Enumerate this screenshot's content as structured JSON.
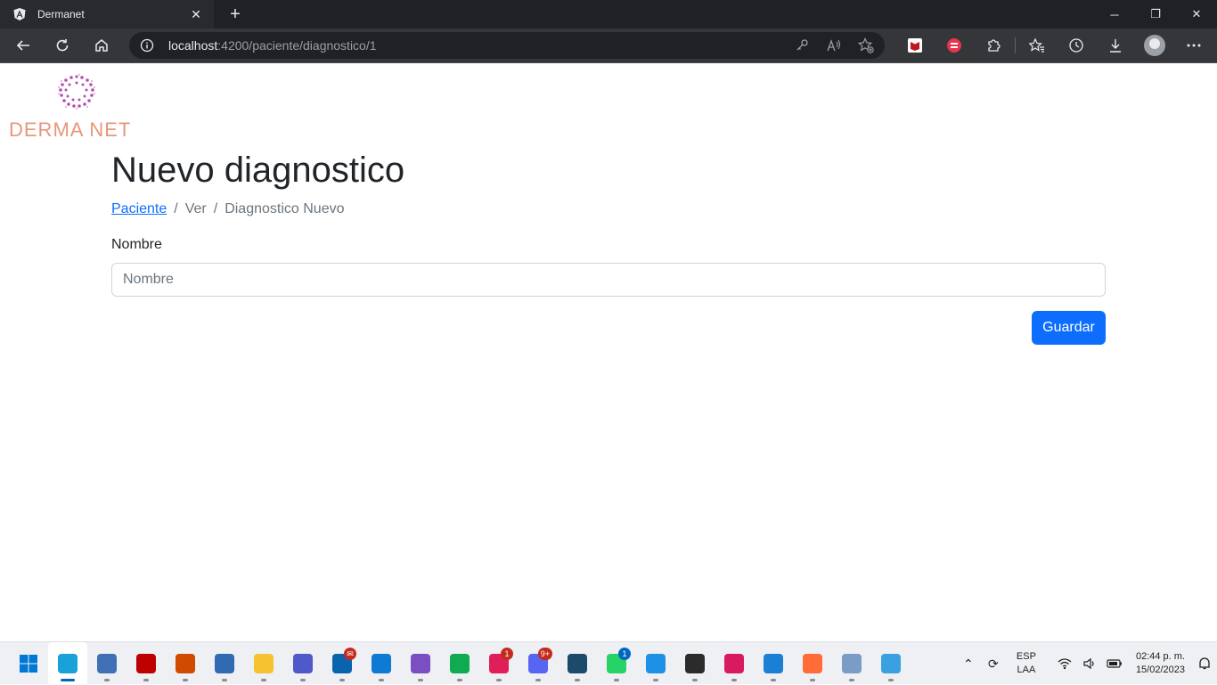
{
  "browser": {
    "tab_title": "Dermanet",
    "url_host": "localhost",
    "url_rest": ":4200/paciente/diagnostico/1"
  },
  "logo": {
    "text": "DERMA NET"
  },
  "page": {
    "title": "Nuevo diagnostico",
    "breadcrumb": [
      "Paciente",
      "Ver",
      "Diagnostico Nuevo"
    ],
    "breadcrumb_divider": "/",
    "field_label": "Nombre",
    "field_placeholder": "Nombre",
    "save_label": "Guardar"
  },
  "taskbar": {
    "apps": [
      {
        "name": "windows-start",
        "color": "#0078d4"
      },
      {
        "name": "edge",
        "color": "#1aa1d8",
        "active": true
      },
      {
        "name": "rss",
        "color": "#3f6fb5"
      },
      {
        "name": "filezilla",
        "color": "#bf0000"
      },
      {
        "name": "remote",
        "color": "#d04a02"
      },
      {
        "name": "network",
        "color": "#2f6ab3"
      },
      {
        "name": "file-explorer",
        "color": "#f5c330"
      },
      {
        "name": "teams",
        "color": "#5059c9"
      },
      {
        "name": "outlook",
        "color": "#0a64ad",
        "badge": "✉"
      },
      {
        "name": "vscode",
        "color": "#0e7ad3"
      },
      {
        "name": "visual-studio",
        "color": "#7b4fc1"
      },
      {
        "name": "mongodb",
        "color": "#10aa50"
      },
      {
        "name": "slack",
        "color": "#e01e5a",
        "badge": "1"
      },
      {
        "name": "discord",
        "color": "#5865f2",
        "badge": "9+"
      },
      {
        "name": "mysql-workbench",
        "color": "#1c4a6b"
      },
      {
        "name": "whatsapp",
        "color": "#25d366",
        "badge": "1",
        "badge_blue": true
      },
      {
        "name": "docker",
        "color": "#1d91e6"
      },
      {
        "name": "terminal",
        "color": "#2b2b2b"
      },
      {
        "name": "intellij",
        "color": "#d81b60"
      },
      {
        "name": "notepad",
        "color": "#1c7fd6"
      },
      {
        "name": "postman",
        "color": "#ff6c37"
      },
      {
        "name": "resource-monitor",
        "color": "#7a9cc6"
      },
      {
        "name": "color-app",
        "color": "#3aa0e0"
      }
    ],
    "lang_line1": "ESP",
    "lang_line2": "LAA",
    "time": "02:44 p. m.",
    "date": "15/02/2023"
  }
}
